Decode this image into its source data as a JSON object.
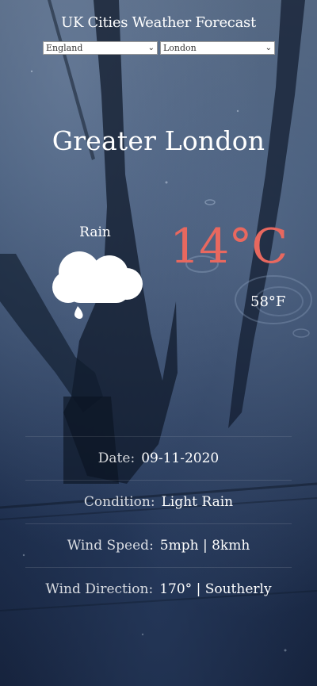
{
  "header": {
    "title": "UK Cities Weather Forecast"
  },
  "selectors": {
    "country": "England",
    "city": "London"
  },
  "location": {
    "name": "Greater London"
  },
  "current": {
    "condition_short": "Rain",
    "icon": "cloud-rain-icon",
    "temp_c": "14°C",
    "temp_f": "58°F"
  },
  "details": {
    "date_label": "Date:",
    "date_value": "09-11-2020",
    "condition_label": "Condition:",
    "condition_value": "Light Rain",
    "wind_speed_label": "Wind Speed:",
    "wind_speed_value": "5mph | 8kmh",
    "wind_direction_label": "Wind Direction:",
    "wind_direction_value": "170° | Southerly"
  },
  "colors": {
    "temperature_accent": "#e8685f",
    "text": "#ffffff"
  }
}
